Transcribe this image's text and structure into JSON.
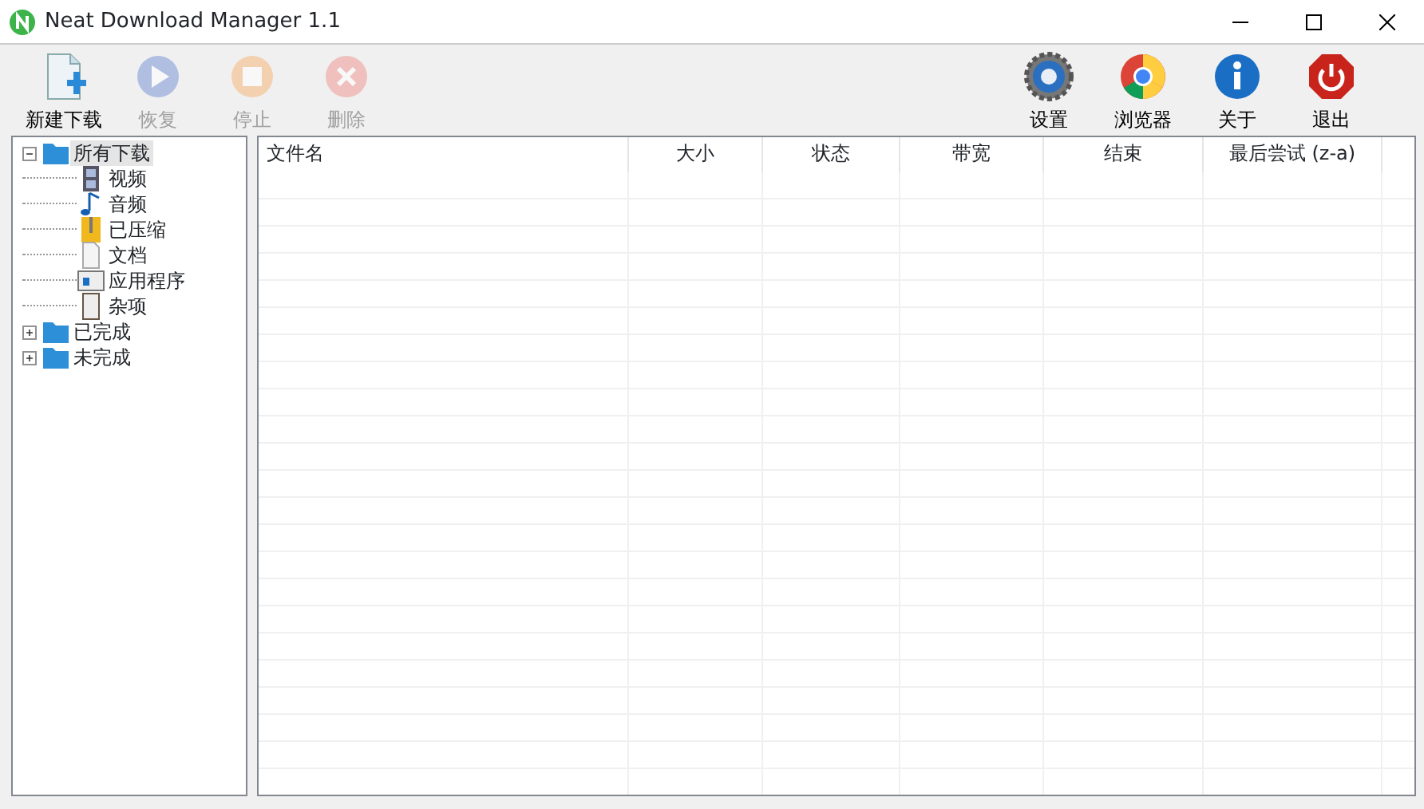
{
  "window": {
    "title": "Neat Download Manager 1.1"
  },
  "toolbar_left": [
    {
      "kind": "new",
      "label": "新建下载",
      "disabled": false
    },
    {
      "kind": "resume",
      "label": "恢复",
      "disabled": true
    },
    {
      "kind": "stop",
      "label": "停止",
      "disabled": true
    },
    {
      "kind": "delete",
      "label": "删除",
      "disabled": true
    }
  ],
  "toolbar_right": [
    {
      "kind": "settings",
      "label": "设置",
      "disabled": false
    },
    {
      "kind": "browser",
      "label": "浏览器",
      "disabled": false
    },
    {
      "kind": "about",
      "label": "关于",
      "disabled": false
    },
    {
      "kind": "exit",
      "label": "退出",
      "disabled": false
    }
  ],
  "tree": [
    {
      "label": "所有下载",
      "kind": "folder",
      "selected": true,
      "expanded": true,
      "children": [
        {
          "label": "视频",
          "kind": "video",
          "selected": false
        },
        {
          "label": "音频",
          "kind": "audio",
          "selected": false
        },
        {
          "label": "已压缩",
          "kind": "zip",
          "selected": false
        },
        {
          "label": "文档",
          "kind": "doc",
          "selected": false
        },
        {
          "label": "应用程序",
          "kind": "app",
          "selected": false
        },
        {
          "label": "杂项",
          "kind": "misc",
          "selected": false
        }
      ]
    },
    {
      "label": "已完成",
      "kind": "folder",
      "selected": false,
      "expanded": false
    },
    {
      "label": "未完成",
      "kind": "folder",
      "selected": false,
      "expanded": false
    }
  ],
  "table": {
    "columns": [
      {
        "label": "文件名"
      },
      {
        "label": "大小"
      },
      {
        "label": "状态"
      },
      {
        "label": "带宽"
      },
      {
        "label": "结束"
      },
      {
        "label": "最后尝试 (z-a)"
      }
    ]
  }
}
